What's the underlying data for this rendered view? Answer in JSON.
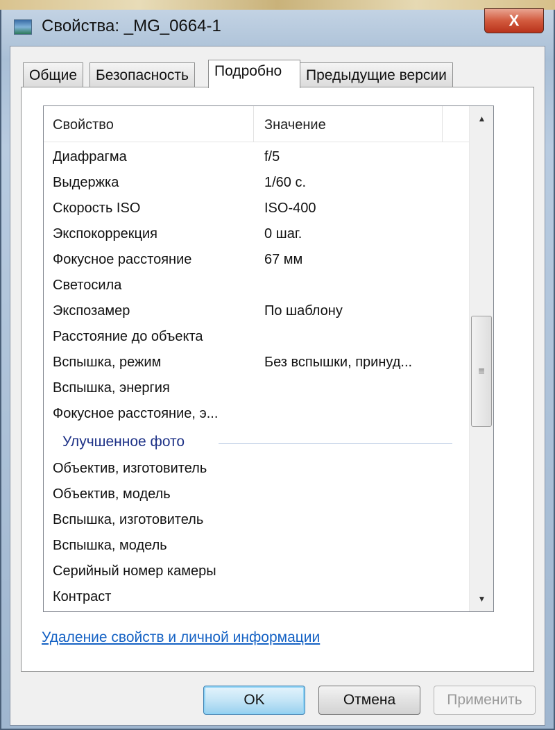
{
  "window": {
    "title": "Свойства: _MG_0664-1",
    "close_label": "X"
  },
  "tabs": [
    {
      "label": "Общие"
    },
    {
      "label": "Безопасность"
    },
    {
      "label": "Подробно",
      "active": true
    },
    {
      "label": "Предыдущие версии"
    }
  ],
  "list": {
    "headers": {
      "property": "Свойство",
      "value": "Значение"
    },
    "rows": [
      {
        "k": "Диафрагма",
        "v": "f/5"
      },
      {
        "k": "Выдержка",
        "v": "1/60 с."
      },
      {
        "k": "Скорость ISO",
        "v": "ISO-400"
      },
      {
        "k": "Экспокоррекция",
        "v": "0 шаг."
      },
      {
        "k": "Фокусное расстояние",
        "v": "67 мм"
      },
      {
        "k": "Светосила",
        "v": ""
      },
      {
        "k": "Экспозамер",
        "v": "По шаблону"
      },
      {
        "k": "Расстояние до объекта",
        "v": ""
      },
      {
        "k": "Вспышка, режим",
        "v": "Без вспышки, принуд..."
      },
      {
        "k": "Вспышка, энергия",
        "v": ""
      },
      {
        "k": "Фокусное расстояние, э...",
        "v": ""
      }
    ],
    "group": "Улучшенное фото",
    "rows2": [
      {
        "k": "Объектив, изготовитель"
      },
      {
        "k": "Объектив, модель"
      },
      {
        "k": "Вспышка, изготовитель"
      },
      {
        "k": "Вспышка, модель"
      },
      {
        "k": "Серийный номер камеры"
      },
      {
        "k": "Контраст"
      }
    ]
  },
  "link": "Удаление свойств и личной информации",
  "buttons": {
    "ok": "OK",
    "cancel": "Отмена",
    "apply": "Применить"
  }
}
